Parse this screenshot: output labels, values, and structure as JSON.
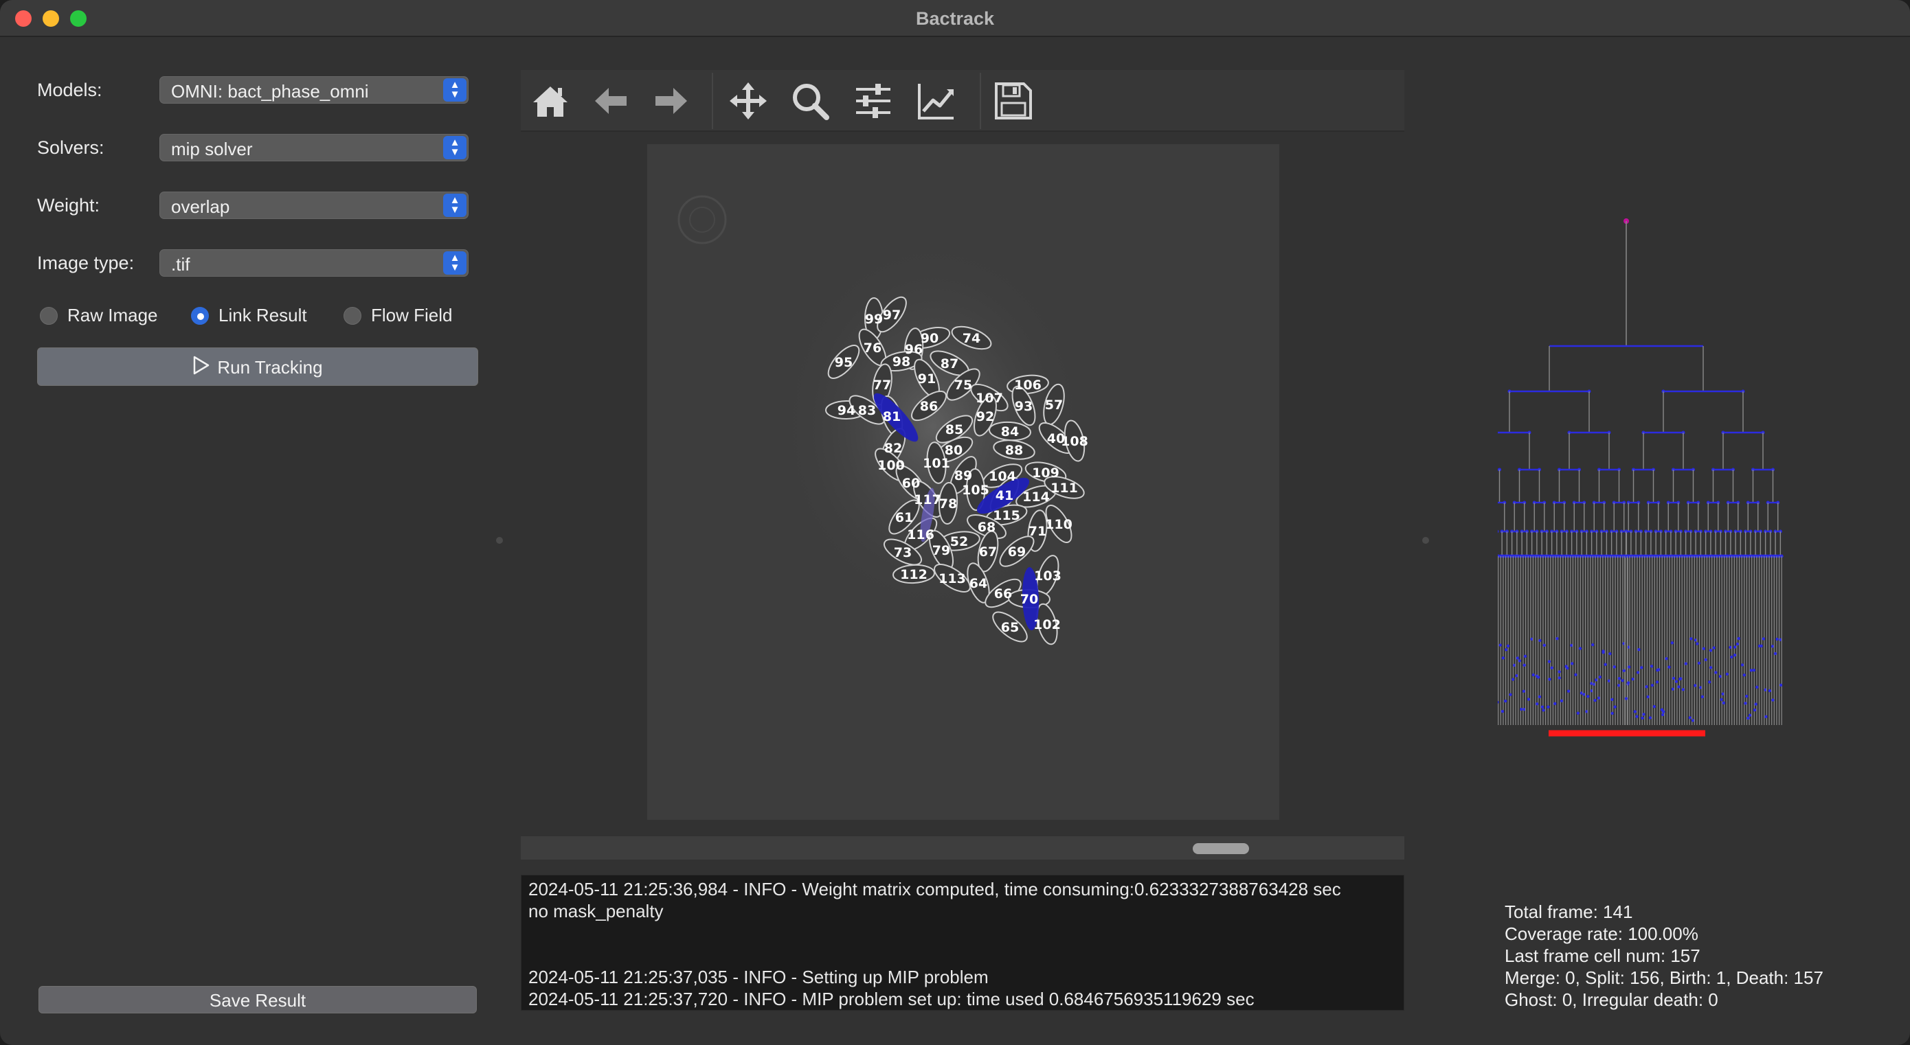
{
  "window": {
    "title": "Bactrack"
  },
  "controls": {
    "models": {
      "label": "Models:",
      "value": "OMNI: bact_phase_omni"
    },
    "solvers": {
      "label": "Solvers:",
      "value": "mip solver"
    },
    "weight": {
      "label": "Weight:",
      "value": "overlap"
    },
    "image_type": {
      "label": "Image type:",
      "value": ".tif"
    }
  },
  "view_modes": [
    {
      "label": "Raw Image",
      "selected": false
    },
    {
      "label": "Link Result",
      "selected": true
    },
    {
      "label": "Flow Field",
      "selected": false
    }
  ],
  "buttons": {
    "run_tracking": "Run Tracking",
    "save_result": "Save Result"
  },
  "toolbar": {
    "icons": [
      "home-icon",
      "back-arrow-icon",
      "forward-arrow-icon",
      "pan-icon",
      "zoom-icon",
      "configure-subplots-icon",
      "edit-axis-icon",
      "save-icon"
    ]
  },
  "cell_labels": [
    "99",
    "97",
    "90",
    "74",
    "76",
    "96",
    "95",
    "98",
    "87",
    "91",
    "77",
    "75",
    "106",
    "107",
    "93",
    "57",
    "86",
    "94",
    "83",
    "81",
    "92",
    "85",
    "84",
    "40",
    "108",
    "82",
    "80",
    "88",
    "100",
    "101",
    "89",
    "104",
    "109",
    "60",
    "105",
    "41",
    "114",
    "111",
    "117",
    "78",
    "61",
    "115",
    "68",
    "110",
    "71",
    "116",
    "52",
    "73",
    "79",
    "67",
    "69",
    "112",
    "113",
    "64",
    "103",
    "66",
    "70",
    "65",
    "102"
  ],
  "log": {
    "lines": [
      "2024-05-11 21:25:36,984 - INFO - Weight matrix computed, time consuming:0.6233327388763428 sec",
      "no mask_penalty",
      "",
      "",
      "2024-05-11 21:25:37,035 - INFO - Setting up MIP problem",
      "2024-05-11 21:25:37,720 - INFO - MIP problem set up: time used 0.6846756935119629 sec"
    ]
  },
  "stats": {
    "total_frame": "Total frame: 141",
    "coverage_rate": "Coverage rate: 100.00%",
    "last_frame_cells": "Last frame cell num: 157",
    "events": "Merge: 0, Split: 156, Birth: 1, Death: 157",
    "ghost": "Ghost: 0, Irregular death: 0"
  },
  "colors": {
    "accent": "#2e6bdc",
    "highlight_cell": "#2020b8",
    "tree_node": "#2b2be0",
    "tree_root": "#c0109a",
    "tree_base": "#ff1a1a"
  }
}
